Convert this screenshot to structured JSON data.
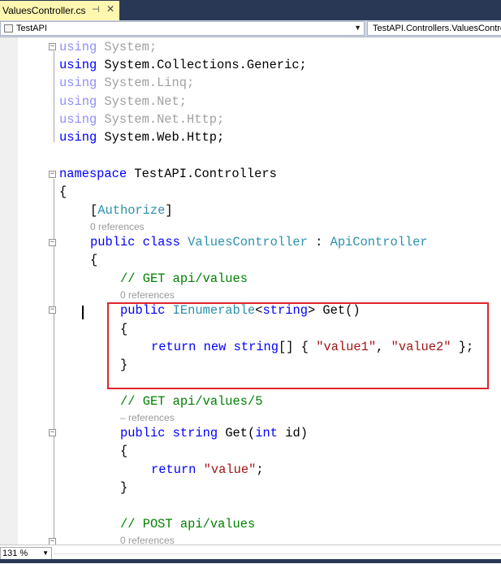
{
  "tab": {
    "filename": "ValuesController.cs",
    "pin_icon": "pin-icon",
    "close_icon": "close-icon"
  },
  "navbar": {
    "project": "TestAPI",
    "member": "TestAPI.Controllers.ValuesController"
  },
  "code": {
    "using1_kw": "using",
    "using1_ns": " System;",
    "using2_kw": "using",
    "using2_ns": " System.Collections.Generic;",
    "using3_kw": "using",
    "using3_ns": " System.Linq;",
    "using4_kw": "using",
    "using4_ns": " System.Net;",
    "using5_kw": "using",
    "using5_ns": " System.Net.Http;",
    "using6_kw": "using",
    "using6_ns": " System.Web.Http;",
    "ns_kw": "namespace",
    "ns_name": " TestAPI.Controllers",
    "open_brace": "{",
    "attr_open": "[",
    "attr_name": "Authorize",
    "attr_close": "]",
    "ref_class": "0 references",
    "class_public": "public",
    "class_kw": " class",
    "class_name": " ValuesController",
    "class_colon": " : ",
    "class_base": "ApiController",
    "class_open": "{",
    "cmt1": "// GET api/values",
    "ref_get1": "0 references",
    "get1_public": "public",
    "get1_type": " IEnumerable",
    "get1_lt": "<",
    "get1_string": "string",
    "get1_rest": "> Get()",
    "get1_open": "{",
    "ret1_kw": "return",
    "ret1_new": " new",
    "ret1_str": " string",
    "ret1_mid": "[] { ",
    "ret1_v1": "\"value1\"",
    "ret1_comma": ", ",
    "ret1_v2": "\"value2\"",
    "ret1_end": " };",
    "get1_close": "}",
    "cmt2": "// GET api/values/5",
    "ref_get2": "– references",
    "get2_public": "public",
    "get2_string": " string",
    "get2_mid": " Get(",
    "get2_int": "int",
    "get2_end": " id)",
    "get2_open": "{",
    "ret2_kw": "return",
    "ret2_val": " \"value\"",
    "ret2_end": ";",
    "get2_close": "}",
    "cmt3": "// POST api/values",
    "ref_post": "0 references"
  },
  "status": {
    "zoom": "131 %"
  },
  "colors": {
    "keyword": "#0000ff",
    "type": "#2b91af",
    "string": "#a31515",
    "comment": "#008000",
    "highlight_box": "#e1242b"
  }
}
